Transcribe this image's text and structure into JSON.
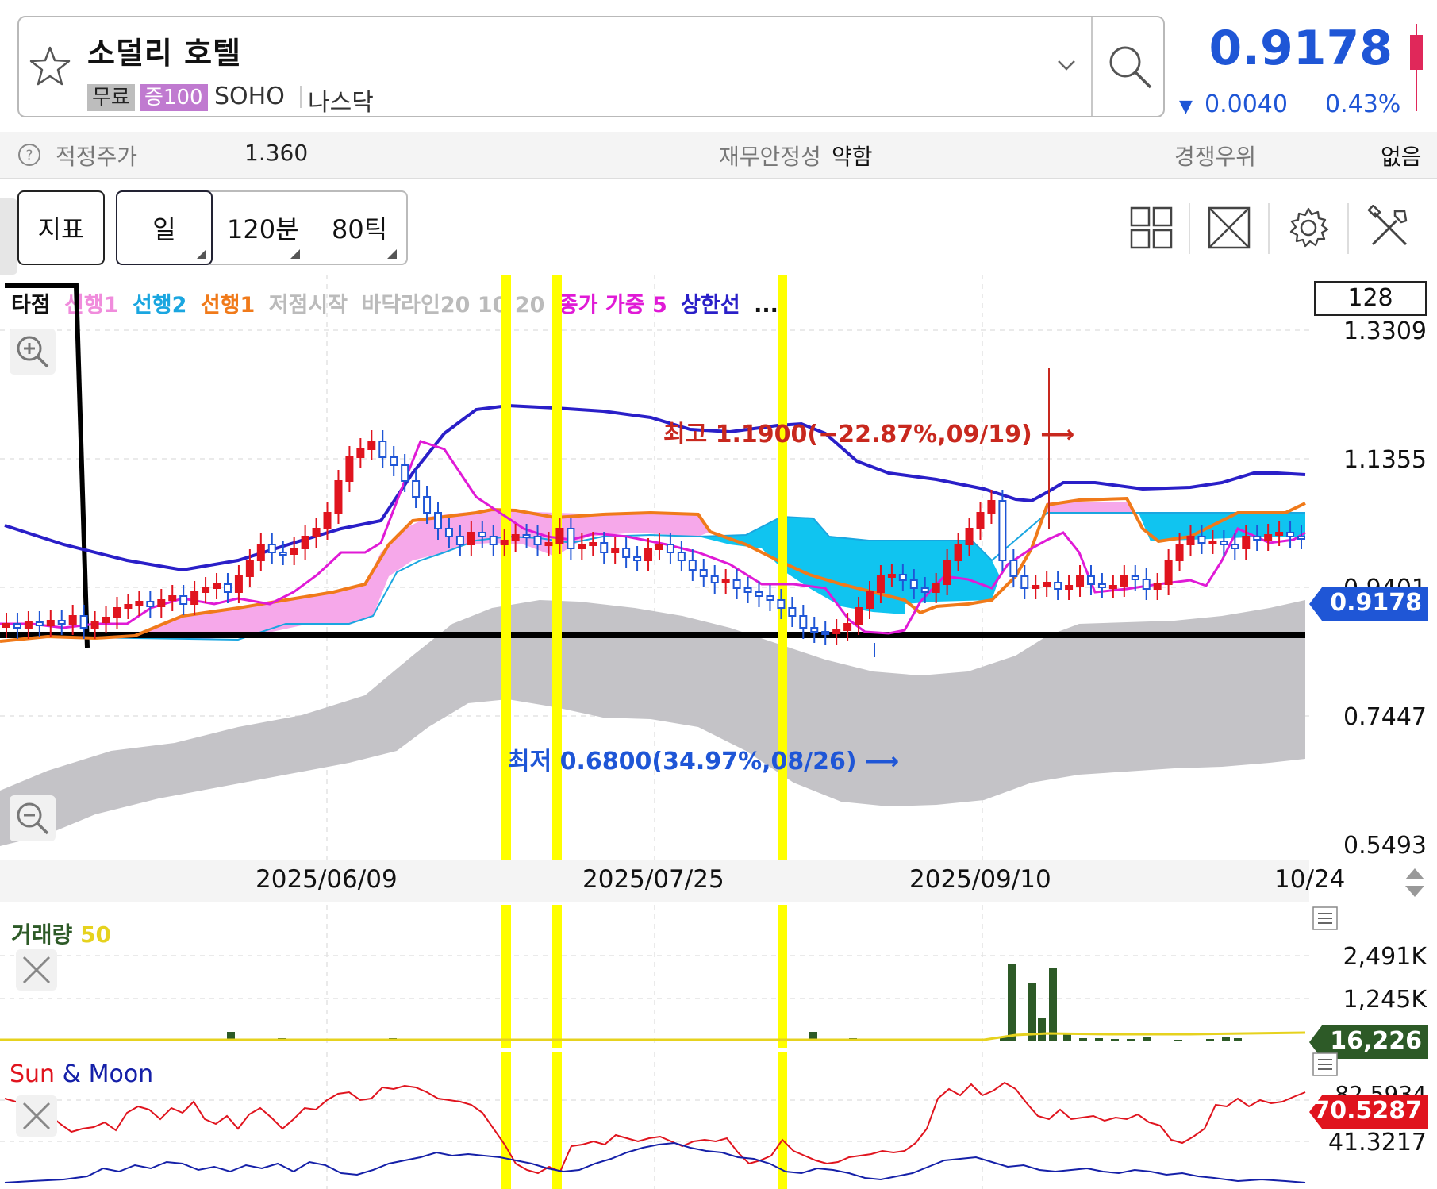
{
  "header": {
    "stock_name": "소덜리 호텔",
    "tag_free": "무료",
    "tag_margin": "증100",
    "ticker": "SOHO",
    "exchange": "나스닥",
    "last_price": "0.9178",
    "change_arrow": "▼",
    "change_abs": "0.0040",
    "change_pct": "0.43%",
    "price_color": "#1f56d6"
  },
  "info_row": {
    "fair_value_label": "적정주가",
    "fair_value": "1.360",
    "stability_label": "재무안정성",
    "stability_value": "약함",
    "competitive_label": "경쟁우위",
    "competitive_value": "없음"
  },
  "toolbar": {
    "indicator_button": "지표",
    "period_day": "일",
    "period_120min": "120분",
    "period_80tick": "80틱",
    "icons": [
      "grid-layout-icon",
      "fullscreen-icon",
      "settings-gear-icon",
      "tools-icon"
    ]
  },
  "legend": {
    "items": [
      {
        "text": "타점",
        "color": "#111111"
      },
      {
        "text": "선행1",
        "color": "#f08cdc"
      },
      {
        "text": "선행2",
        "color": "#1aa6e0"
      },
      {
        "text": "선행1",
        "color": "#f07a1a"
      },
      {
        "text": "저점시작",
        "color": "#bbbbbb"
      },
      {
        "text": "바닥라인20 10 20",
        "color": "#bbbbbb"
      },
      {
        "text": "종가 가중 5",
        "color": "#e01ad6"
      },
      {
        "text": "상한선",
        "color": "#2a1fc8"
      },
      {
        "text": "...",
        "color": "#111111"
      }
    ],
    "count": "128"
  },
  "price_axis": {
    "labels": [
      "1.3309",
      "1.1355",
      "0.9401",
      "0.7447",
      "0.5493"
    ],
    "current": "0.9178",
    "current_color": "#1f56d6"
  },
  "annotations": {
    "high": "최고 1.1900(−22.87%,09/19) ⟶",
    "low": "최저 0.6800(34.97%,08/26) ⟶"
  },
  "time_axis": {
    "labels": [
      "2025/06/09",
      "2025/07/25",
      "2025/09/10",
      "10/24"
    ]
  },
  "volume_panel": {
    "title": "거래량",
    "period": "50",
    "labels": [
      "2,491K",
      "1,245K"
    ],
    "current": "16,226",
    "current_color": "#2d5a27"
  },
  "sun_moon_panel": {
    "title_sun": "Sun",
    "title_amp": "&",
    "title_moon": "Moon",
    "top_label": "82.5934",
    "current": "70.5287",
    "current_color": "#e0141e",
    "bottom_label": "41.3217"
  },
  "chart_data": {
    "type": "candlestick",
    "title": "",
    "x_range": [
      "2025-05",
      "2025-10-24"
    ],
    "ylim": [
      0.5493,
      1.3309
    ],
    "high": {
      "value": 1.19,
      "date": "09/19",
      "pct": -22.87
    },
    "low": {
      "value": 0.68,
      "date": "08/26",
      "pct": 34.97
    },
    "last": 0.9178,
    "highlight_columns": 3,
    "series": [
      {
        "name": "종가 가중 5",
        "color": "#e01ad6"
      },
      {
        "name": "상한선",
        "color": "#2a1fc8"
      },
      {
        "name": "선행1",
        "color": "#f07a1a"
      }
    ]
  }
}
